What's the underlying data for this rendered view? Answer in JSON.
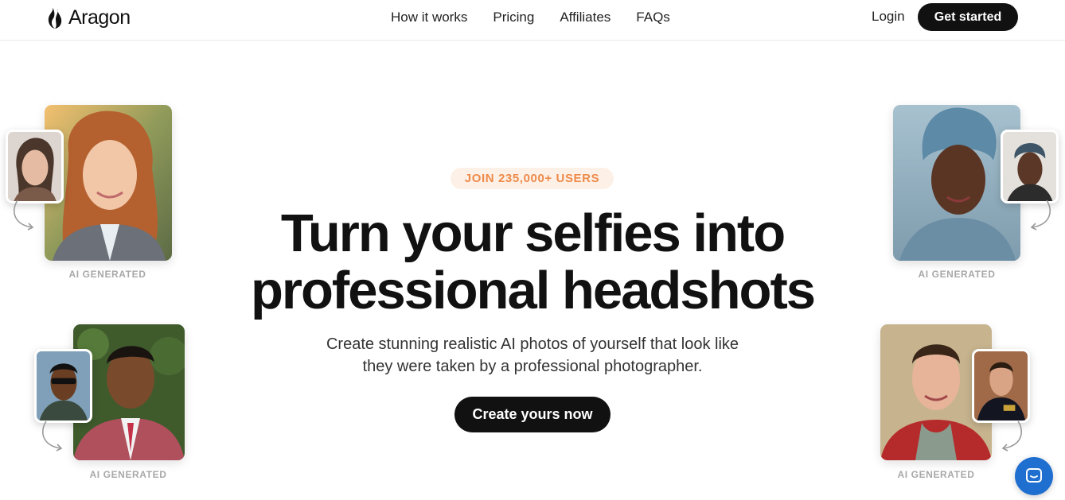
{
  "header": {
    "logo_text": "Aragon",
    "nav": [
      "How it works",
      "Pricing",
      "Affiliates",
      "FAQs"
    ],
    "login_label": "Login",
    "get_started_label": "Get started"
  },
  "hero": {
    "badge": "JOIN 235,000+ USERS",
    "headline_line1": "Turn your selfies into",
    "headline_line2": "professional headshots",
    "subtext_line1": "Create stunning realistic AI photos of yourself that look like",
    "subtext_line2": "they were taken by a professional photographer.",
    "cta_label": "Create yours now"
  },
  "captions": {
    "top_left": "AI GENERATED",
    "bottom_left": "AI GENERATED",
    "top_right": "AI GENERATED",
    "bottom_right": "AI GENERATED"
  },
  "icons": {
    "logo": "flame-logo-icon",
    "chat": "chat-icon"
  },
  "colors": {
    "primary": "#111111",
    "badge_bg": "#fdf1e7",
    "badge_text": "#ee8a4a",
    "chat": "#1f6fd1"
  }
}
